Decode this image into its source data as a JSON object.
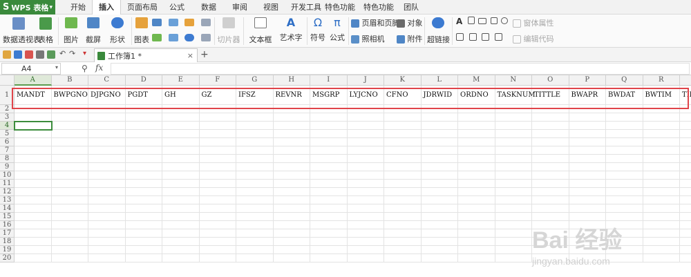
{
  "app": {
    "title": "WPS 表格",
    "logo": "S"
  },
  "menu_tabs": [
    "开始",
    "插入",
    "页面布局",
    "公式",
    "数据",
    "审阅",
    "视图",
    "开发工具",
    "特色功能",
    "特色功能",
    "团队"
  ],
  "active_menu_tab": "插入",
  "ribbon": {
    "pivot_table": "数据透视表",
    "table": "表格",
    "picture": "图片",
    "screenshot": "截屏",
    "shapes": "形状",
    "chart": "图表",
    "slicer": "切片器",
    "textbox": "文本框",
    "wordart": "艺术字",
    "symbol": "符号",
    "formula": "公式",
    "header_footer": "页眉和页脚",
    "object": "对象",
    "camera": "照相机",
    "attachment": "附件",
    "hyperlink": "超链接",
    "window_properties": "窗体属性",
    "edit_code": "编辑代码"
  },
  "document_tab": {
    "name": "工作簿1 *",
    "close": "×"
  },
  "new_tab": "+",
  "formula_bar": {
    "name_box": "A4",
    "fx": "fx",
    "value": ""
  },
  "columns": [
    "A",
    "B",
    "C",
    "D",
    "E",
    "F",
    "G",
    "H",
    "I",
    "J",
    "K",
    "L",
    "M",
    "N",
    "O",
    "P",
    "Q",
    "R"
  ],
  "rows": [
    "1",
    "2",
    "3",
    "4",
    "5",
    "6",
    "7",
    "8",
    "9",
    "10",
    "11",
    "12",
    "13",
    "14",
    "15",
    "16",
    "17",
    "18",
    "19",
    "20"
  ],
  "active_column": "A",
  "active_row": "4",
  "row1_values": [
    "MANDT",
    "BWPGNO",
    "DJPGNO",
    "PGDT",
    "GH",
    "GZ",
    "IFSZ",
    "REVNR",
    "MSGRP",
    "LYJCNO",
    "CFNO",
    "JDRWID",
    "ORDNO",
    "TASKNUM",
    "TITTLE",
    "BWAPR",
    "BWDAT",
    "BWTIM",
    "TII"
  ],
  "watermark": {
    "logo": "Bai 经验",
    "url": "jingyan.baidu.com"
  },
  "colors": {
    "accent_green": "#3a8a3c",
    "highlight_red": "#e0444a"
  }
}
